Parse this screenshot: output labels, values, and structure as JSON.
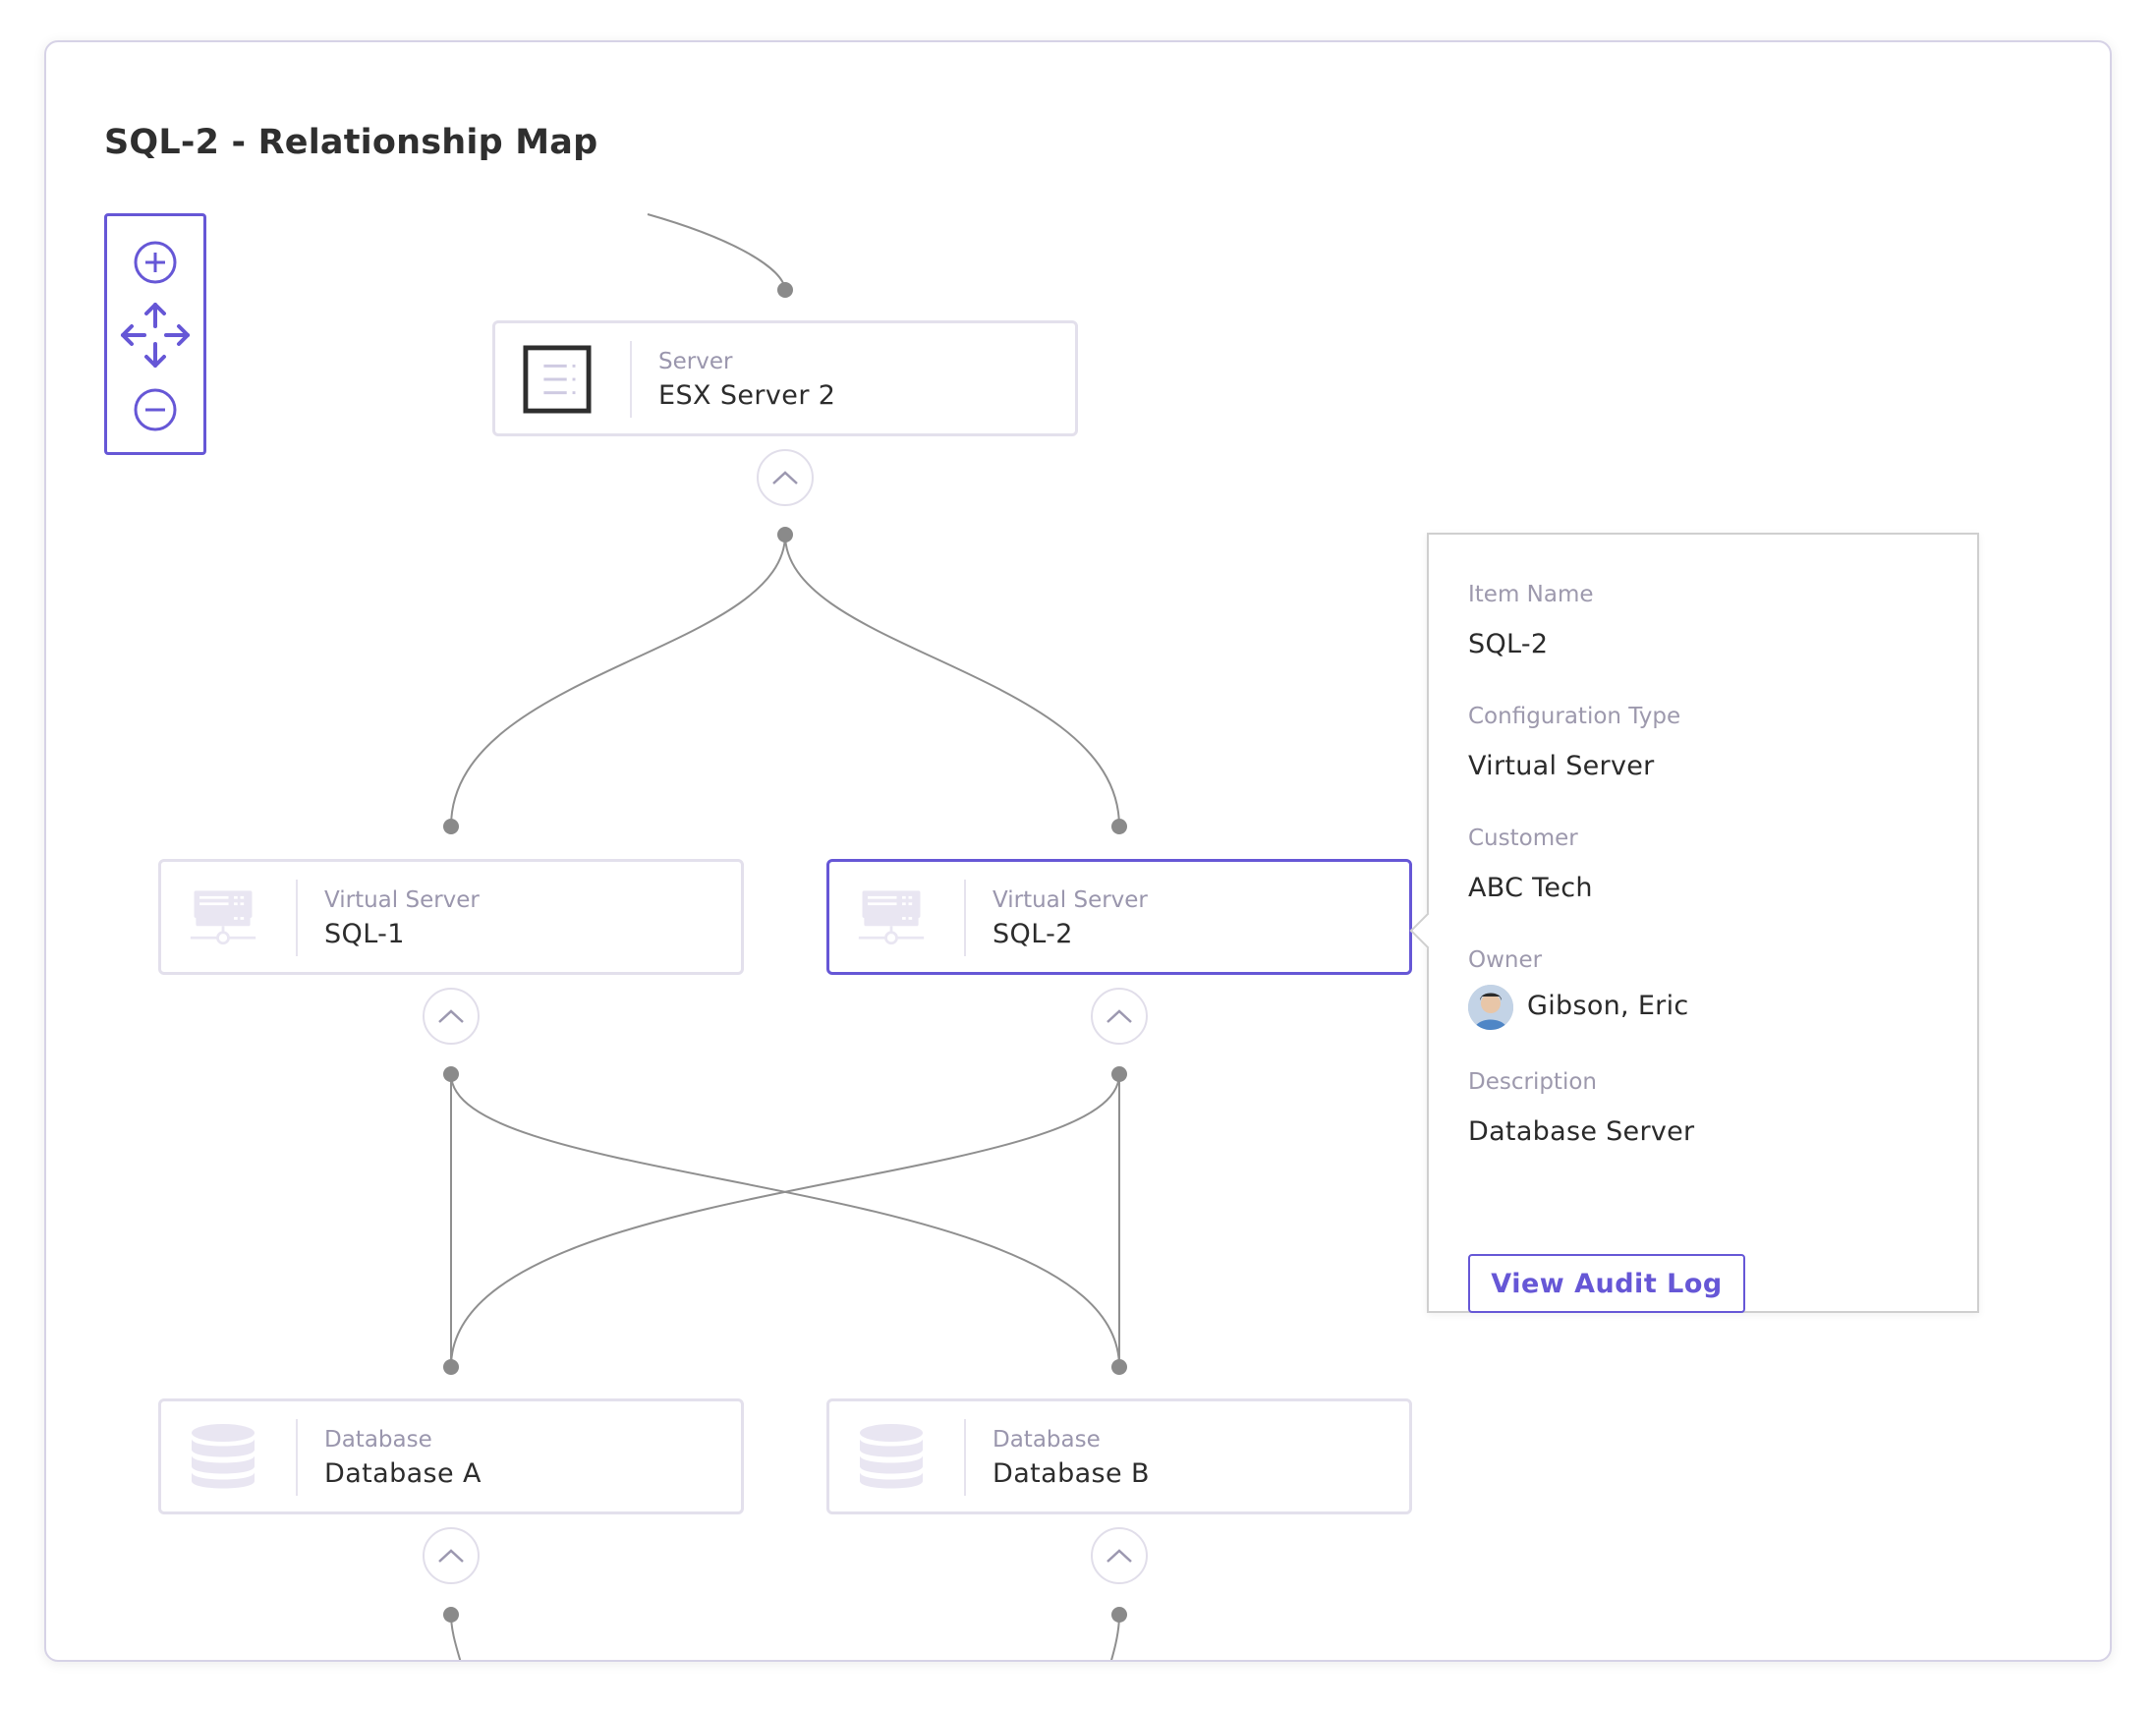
{
  "title": "SQL-2 - Relationship Map",
  "accent_color": "#6657d6",
  "zoom_controls": [
    "zoom-in-icon",
    "pan-icon",
    "zoom-out-icon"
  ],
  "nodes": [
    {
      "type": "Server",
      "name": "ESX Server 2",
      "icon": "server-icon"
    },
    {
      "type": "Virtual Server",
      "name": "SQL-1",
      "icon": "virtual-server-icon"
    },
    {
      "type": "Virtual Server",
      "name": "SQL-2",
      "icon": "virtual-server-icon",
      "selected": true
    },
    {
      "type": "Database",
      "name": "Database A",
      "icon": "database-icon"
    },
    {
      "type": "Database",
      "name": "Database B",
      "icon": "database-icon"
    }
  ],
  "details": {
    "item_name_label": "Item Name",
    "item_name": "SQL-2",
    "config_type_label": "Configuration Type",
    "config_type": "Virtual Server",
    "customer_label": "Customer",
    "customer": "ABC Tech",
    "owner_label": "Owner",
    "owner": "Gibson, Eric",
    "description_label": "Description",
    "description": "Database Server",
    "audit_button": "View Audit Log"
  }
}
